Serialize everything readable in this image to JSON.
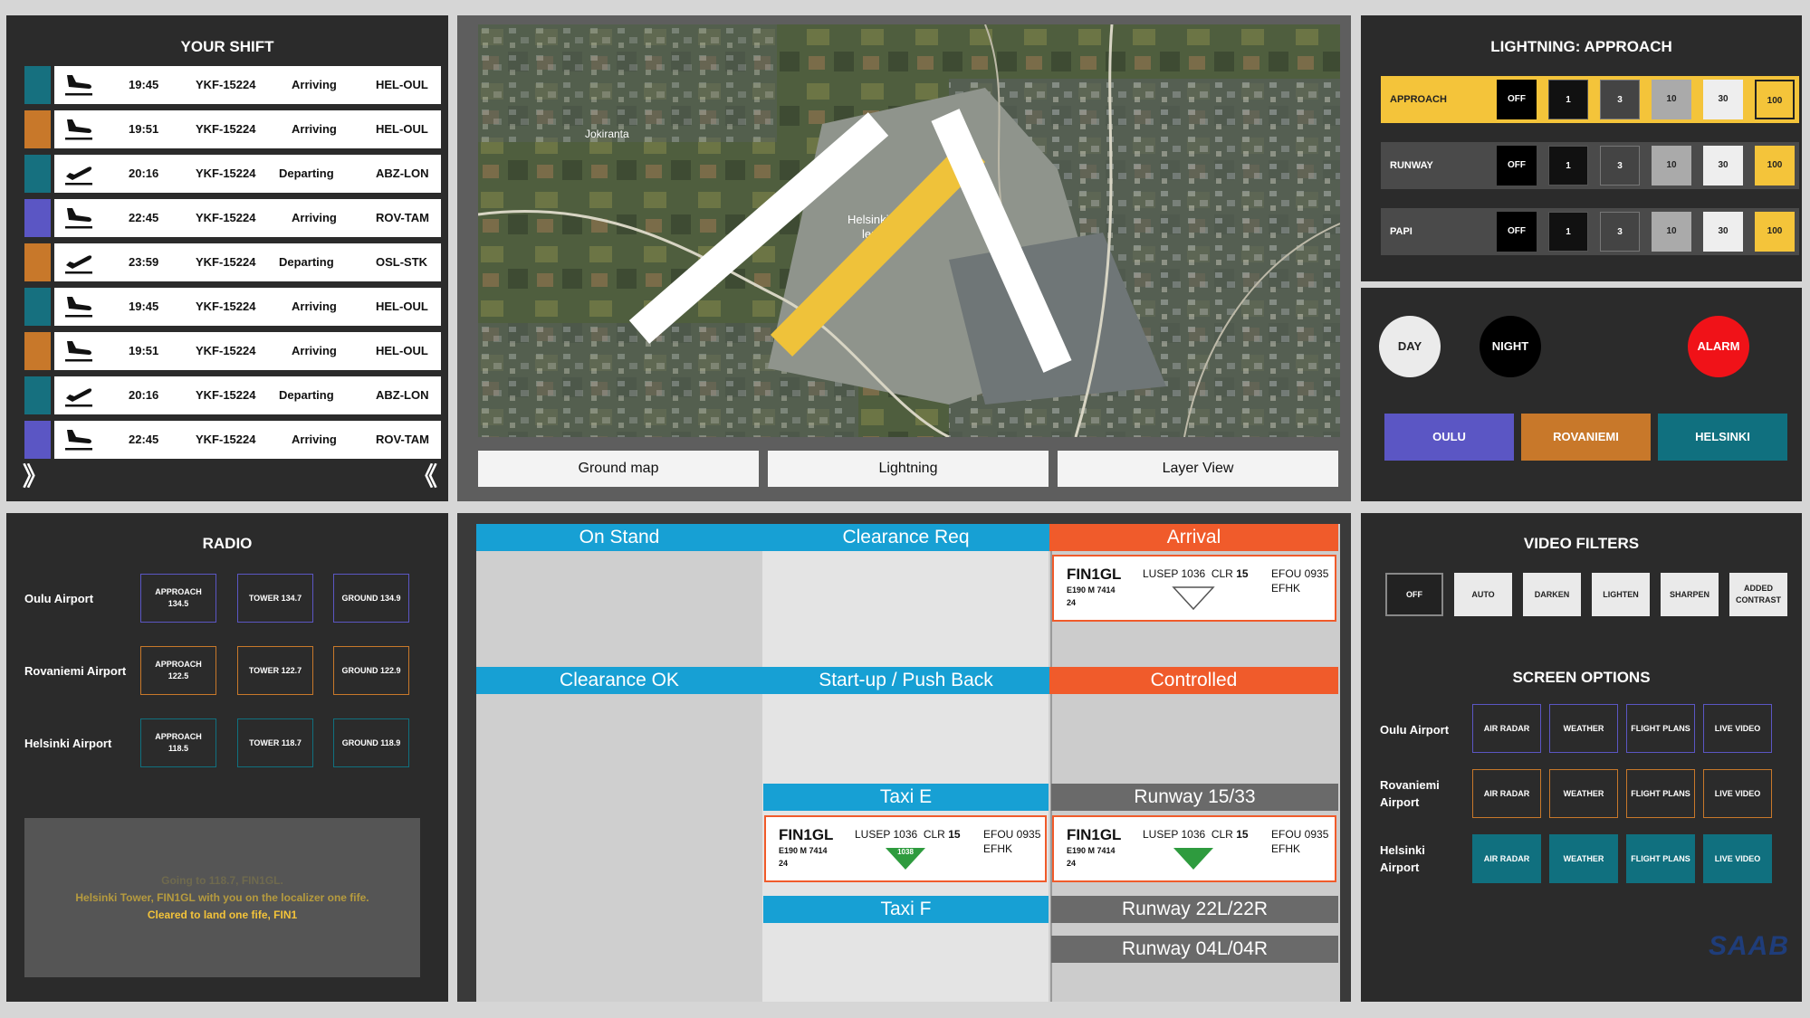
{
  "shift": {
    "title": "YOUR SHIFT",
    "rows": [
      {
        "color": "#16707f",
        "type": "arrival",
        "time": "19:45",
        "id": "YKF-15224",
        "status": "Arriving",
        "route": "HEL-OUL"
      },
      {
        "color": "#c8782a",
        "type": "arrival",
        "time": "19:51",
        "id": "YKF-15224",
        "status": "Arriving",
        "route": "HEL-OUL"
      },
      {
        "color": "#16707f",
        "type": "departure",
        "time": "20:16",
        "id": "YKF-15224",
        "status": "Departing",
        "route": "ABZ-LON"
      },
      {
        "color": "#5b56c4",
        "type": "arrival",
        "time": "22:45",
        "id": "YKF-15224",
        "status": "Arriving",
        "route": "ROV-TAM"
      },
      {
        "color": "#c8782a",
        "type": "departure",
        "time": "23:59",
        "id": "YKF-15224",
        "status": "Departing",
        "route": "OSL-STK"
      },
      {
        "color": "#16707f",
        "type": "arrival",
        "time": "19:45",
        "id": "YKF-15224",
        "status": "Arriving",
        "route": "HEL-OUL"
      },
      {
        "color": "#c8782a",
        "type": "arrival",
        "time": "19:51",
        "id": "YKF-15224",
        "status": "Arriving",
        "route": "HEL-OUL"
      },
      {
        "color": "#16707f",
        "type": "departure",
        "time": "20:16",
        "id": "YKF-15224",
        "status": "Departing",
        "route": "ABZ-LON"
      },
      {
        "color": "#5b56c4",
        "type": "arrival",
        "time": "22:45",
        "id": "YKF-15224",
        "status": "Arriving",
        "route": "ROV-TAM"
      }
    ]
  },
  "map": {
    "labels": {
      "jokiranta": "Jokiranta",
      "airport_line1": "Helsinki-Van",
      "airport_line2": "lentoas"
    },
    "buttons": [
      "Ground map",
      "Lightning",
      "Layer View"
    ]
  },
  "lightning": {
    "title": "LIGHTNING: APPROACH",
    "rows": [
      {
        "name": "APPROACH",
        "active": true
      },
      {
        "name": "RUNWAY",
        "active": false
      },
      {
        "name": "PAPI",
        "active": false
      }
    ],
    "levels": [
      "OFF",
      "1",
      "3",
      "10",
      "30",
      "100"
    ]
  },
  "mode": {
    "day": "DAY",
    "night": "NIGHT",
    "alarm": "ALARM"
  },
  "cities": [
    {
      "label": "OULU",
      "color": "#5b56c4"
    },
    {
      "label": "ROVANIEMI",
      "color": "#c8782a"
    },
    {
      "label": "HELSINKI",
      "color": "#10707f"
    }
  ],
  "radio": {
    "title": "RADIO",
    "airports": [
      {
        "name": "Oulu Airport",
        "color": "#5b56c4",
        "freqs": [
          [
            "APPROACH",
            "134.5"
          ],
          [
            "TOWER 134.7"
          ],
          [
            "GROUND 134.9"
          ]
        ]
      },
      {
        "name": "Rovaniemi Airport",
        "color": "#c8782a",
        "freqs": [
          [
            "APPROACH",
            "122.5"
          ],
          [
            "TOWER 122.7"
          ],
          [
            "GROUND 122.9"
          ]
        ]
      },
      {
        "name": "Helsinki Airport",
        "color": "#10707f",
        "freqs": [
          [
            "APPROACH",
            "118.5"
          ],
          [
            "TOWER 118.7"
          ],
          [
            "GROUND 118.9"
          ]
        ]
      }
    ],
    "transcript": {
      "line1": "Going to 118.7, FIN1GL.",
      "line2": "Helsinki Tower, FIN1GL with you on the localizer one fife.",
      "line3": "Cleared to land one fife, FIN1"
    }
  },
  "board": {
    "headers": {
      "on_stand": "On Stand",
      "clearance_req": "Clearance Req",
      "arrival": "Arrival",
      "clearance_ok": "Clearance OK",
      "startup": "Start-up / Push Back",
      "controlled": "Controlled",
      "taxi_e": "Taxi E",
      "taxi_f": "Taxi F",
      "rwy1533": "Runway 15/33",
      "rwy22": "Runway 22L/22R",
      "rwy04": "Runway 04L/04R"
    },
    "flight": {
      "callsign": "FIN1GL",
      "type": "E190 M 7414",
      "n": "24",
      "lusep": "LUSEP 1036",
      "clr_label": "CLR",
      "clr": "15",
      "efou": "EFOU 0935",
      "efhk": "EFHK",
      "badge": "1038"
    }
  },
  "video": {
    "title": "VIDEO FILTERS",
    "filters": [
      "OFF",
      "AUTO",
      "DARKEN",
      "LIGHTEN",
      "SHARPEN",
      "ADDED CONTRAST"
    ]
  },
  "screen": {
    "title": "SCREEN OPTIONS",
    "airports": [
      {
        "name": "Oulu Airport",
        "color": "#5b56c4",
        "fill": false
      },
      {
        "name": "Rovaniemi Airport",
        "color": "#c8782a",
        "fill": false
      },
      {
        "name": "Helsinki Airport",
        "color": "#10707f",
        "fill": true
      }
    ],
    "options": [
      "AIR RADAR",
      "WEATHER",
      "FLIGHT PLANS",
      "LIVE VIDEO"
    ]
  },
  "brand": "SAAB"
}
